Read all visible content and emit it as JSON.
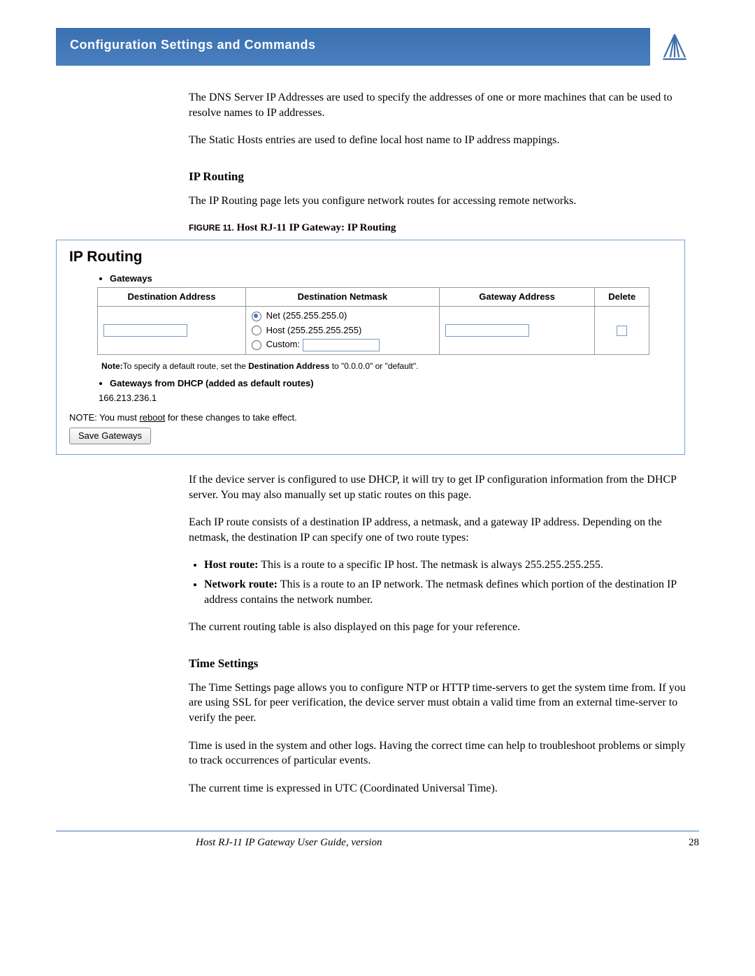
{
  "header": {
    "title": "Configuration Settings and Commands"
  },
  "intro": {
    "p1": "The DNS Server IP Addresses are used to specify the addresses of one or more machines that can be used to resolve names to IP addresses.",
    "p2": "The Static Hosts entries are used to define local host name to IP address mappings."
  },
  "ip_routing": {
    "heading": "IP Routing",
    "intro": "The IP Routing page lets you configure network routes for accessing remote networks.",
    "figure_label": "FIGURE 11.",
    "figure_title": " Host RJ-11 IP Gateway: IP Routing",
    "screenshot": {
      "title": "IP Routing",
      "bullet_gateways": "Gateways",
      "th1": "Destination Address",
      "th2": "Destination Netmask",
      "th3": "Gateway Address",
      "th4": "Delete",
      "radio_net": "Net (255.255.255.0)",
      "radio_host": "Host (255.255.255.255)",
      "radio_custom": "Custom:",
      "note_prefix": "Note:",
      "note_text": "To specify a default route, set the ",
      "note_bold": "Destination Address",
      "note_rest": " to \"0.0.0.0\" or \"default\".",
      "bullet_dhcp": "Gateways from DHCP (added as default routes)",
      "dhcp_ip": "166.213.236.1",
      "reboot_note_pre": "NOTE: You must ",
      "reboot_link": "reboot",
      "reboot_note_post": " for these changes to take effect.",
      "save_button": "Save Gateways"
    },
    "after1": "If the device server is configured to use DHCP, it will try to get IP configuration information from the DHCP server. You may also manually set up static routes on this page.",
    "after2": "Each IP route consists of a destination IP address, a netmask, and a gateway IP address. Depending on the netmask, the destination IP can specify one of two route types:",
    "list_host_b": "Host route:",
    "list_host_t": " This is a route to a specific IP host. The netmask is always 255.255.255.255.",
    "list_net_b": "Network route:",
    "list_net_t": " This is a route to an IP network. The netmask defines which portion of the destination IP address contains the network number.",
    "after3": "The current routing table is also displayed on this page for your reference."
  },
  "time": {
    "heading": "Time Settings",
    "p1": "The Time Settings page allows you to configure NTP or HTTP time-servers to get the system time from. If you are using SSL for peer verification, the device server must obtain a valid time from an external time-server to verify the peer.",
    "p2": "Time is used in the system and other logs. Having the correct time can help to troubleshoot problems or simply to track occurrences of particular events.",
    "p3": "The current time is expressed in UTC (Coordinated Universal Time)."
  },
  "footer": {
    "left": "Host RJ-11 IP Gateway User Guide, version",
    "page": "28"
  }
}
